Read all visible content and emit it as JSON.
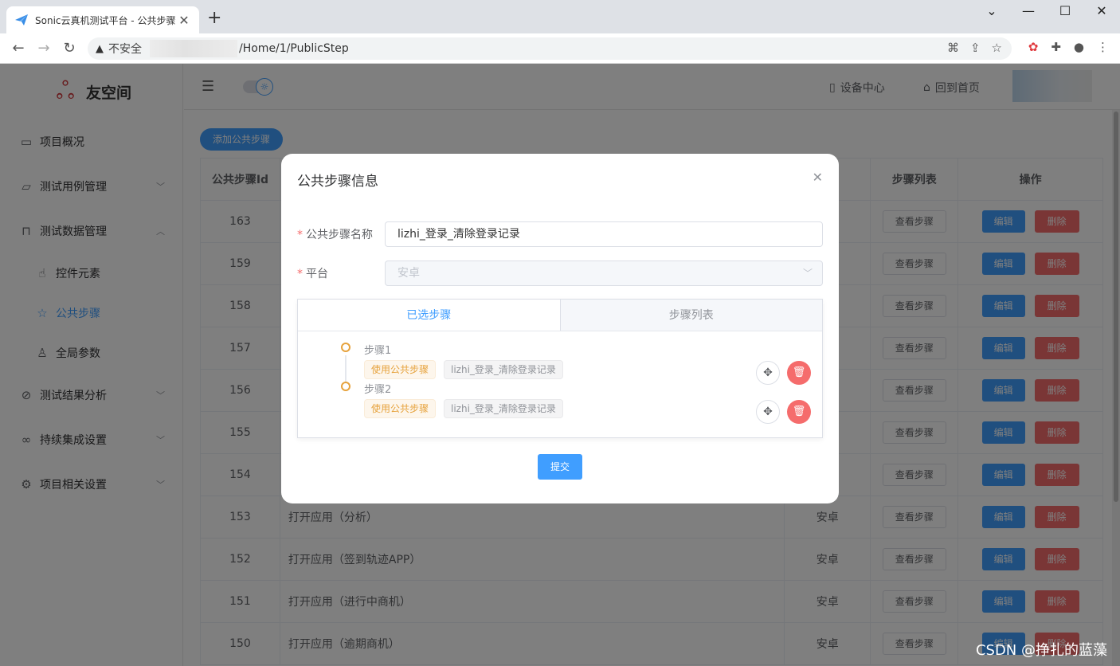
{
  "browser": {
    "tab_title": "Sonic云真机测试平台 - 公共步骤",
    "new_tab": "+",
    "insecure_label": "不安全",
    "url_path": "/Home/1/PublicStep"
  },
  "app": {
    "logo_text": "友空间"
  },
  "sidebar": {
    "items": [
      {
        "label": "项目概况",
        "icon": "presentation-icon"
      },
      {
        "label": "测试用例管理",
        "icon": "folder-icon"
      },
      {
        "label": "测试数据管理",
        "icon": "lock-icon"
      },
      {
        "label": "控件元素",
        "icon": "pointer-icon"
      },
      {
        "label": "公共步骤",
        "icon": "star-icon"
      },
      {
        "label": "全局参数",
        "icon": "user-icon"
      },
      {
        "label": "测试结果分析",
        "icon": "paperclip-icon"
      },
      {
        "label": "持续集成设置",
        "icon": "link-icon"
      },
      {
        "label": "项目相关设置",
        "icon": "gear-icon"
      }
    ]
  },
  "header": {
    "device_center": "设备中心",
    "back_home": "回到首页"
  },
  "main": {
    "add_button": "添加公共步骤",
    "columns": {
      "id": "公共步骤Id",
      "steps": "步骤列表",
      "ops": "操作"
    },
    "row_labels": {
      "view": "查看步骤",
      "edit": "编辑",
      "delete": "删除"
    },
    "rows": [
      {
        "id": "163",
        "name": "",
        "platform": ""
      },
      {
        "id": "159",
        "name": "",
        "platform": ""
      },
      {
        "id": "158",
        "name": "",
        "platform": ""
      },
      {
        "id": "157",
        "name": "",
        "platform": ""
      },
      {
        "id": "156",
        "name": "",
        "platform": ""
      },
      {
        "id": "155",
        "name": "",
        "platform": ""
      },
      {
        "id": "154",
        "name": "",
        "platform": ""
      },
      {
        "id": "153",
        "name": "打开应用（分析）",
        "platform": "安卓"
      },
      {
        "id": "152",
        "name": "打开应用（签到轨迹APP）",
        "platform": "安卓"
      },
      {
        "id": "151",
        "name": "打开应用（进行中商机）",
        "platform": "安卓"
      },
      {
        "id": "150",
        "name": "打开应用（逾期商机）",
        "platform": "安卓"
      }
    ]
  },
  "dialog": {
    "title": "公共步骤信息",
    "name_label": "公共步骤名称",
    "name_value": "lizhi_登录_清除登录记录",
    "platform_label": "平台",
    "platform_value": "安卓",
    "tab_selected": "已选步骤",
    "tab_list": "步骤列表",
    "steps": [
      {
        "title": "步骤1",
        "tag": "使用公共步骤",
        "ref": "lizhi_登录_清除登录记录"
      },
      {
        "title": "步骤2",
        "tag": "使用公共步骤",
        "ref": "lizhi_登录_清除登录记录"
      }
    ],
    "submit": "提交"
  },
  "watermark": "CSDN @挣扎的蓝藻",
  "colors": {
    "primary": "#409eff",
    "danger": "#f56c6c",
    "warning": "#e6a23c"
  }
}
